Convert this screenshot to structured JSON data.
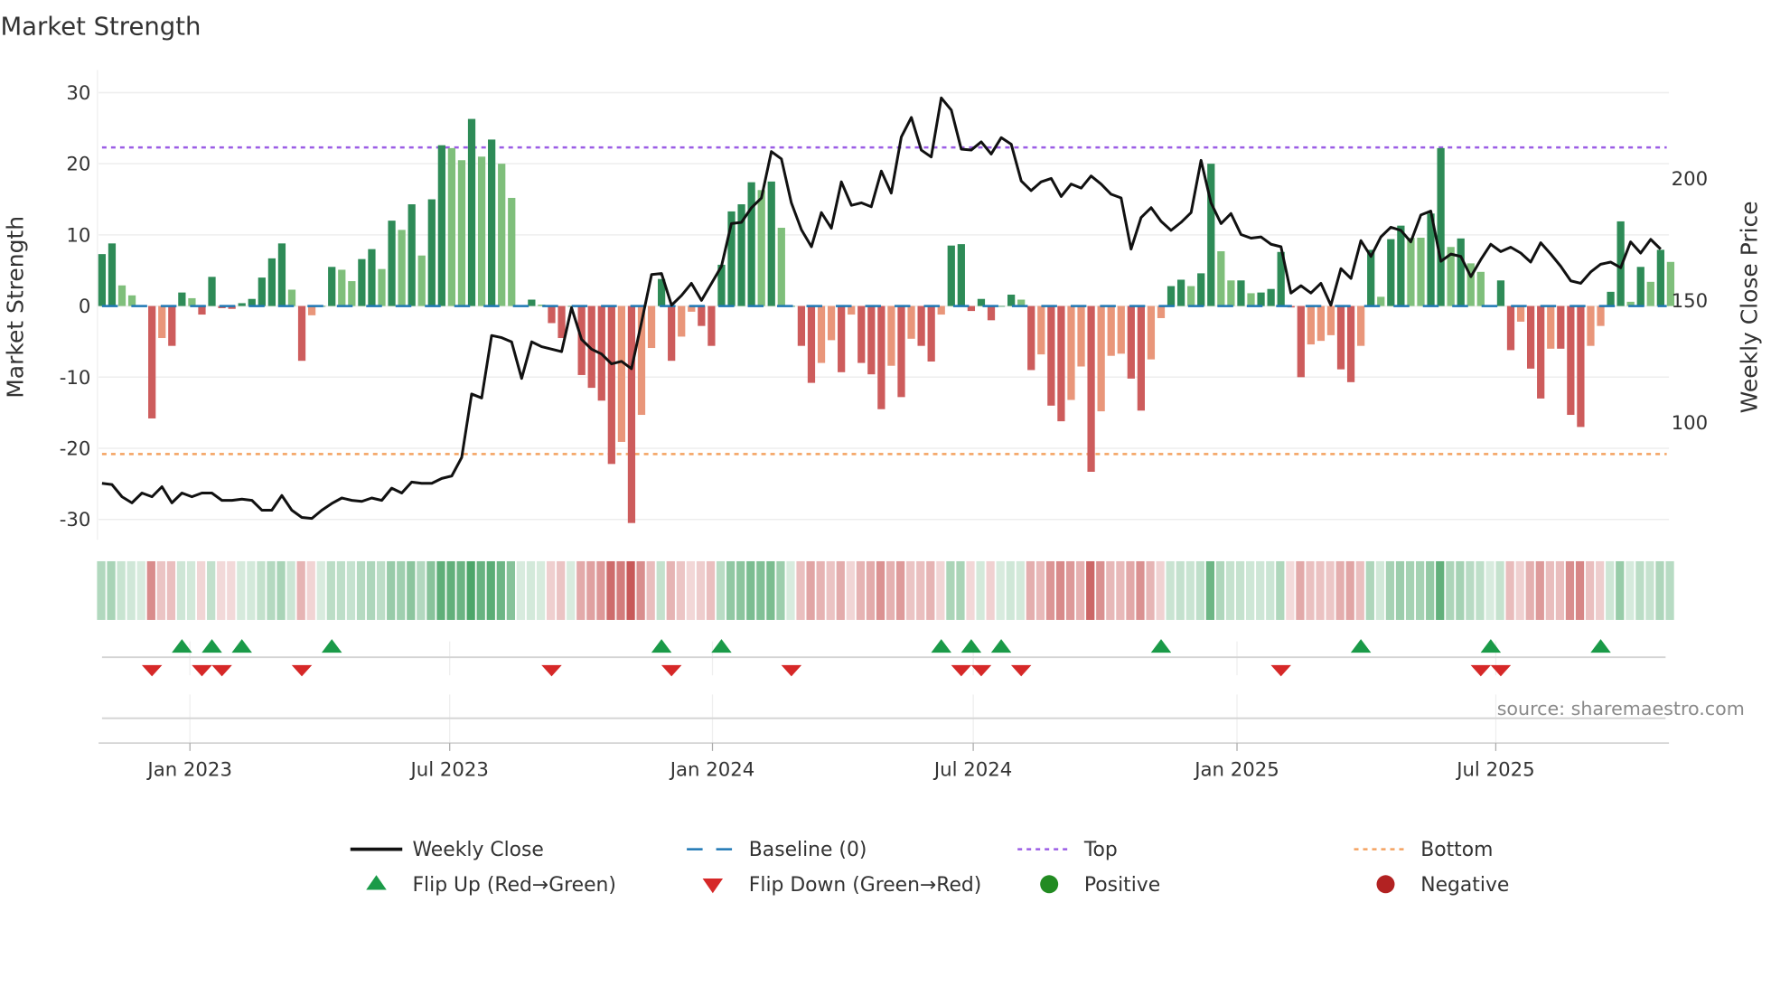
{
  "chart_data": {
    "type": "bar",
    "title": "Market Strength",
    "ylabel": "Market Strength",
    "y2label": "Weekly Close Price",
    "ylim": [
      -32,
      32
    ],
    "y2lim": [
      50,
      240
    ],
    "yticks": [
      30,
      20,
      10,
      0,
      -10,
      -20,
      -30
    ],
    "y2ticks": [
      200,
      150,
      100
    ],
    "top_level": 22.3,
    "bottom_level": -20.8,
    "baseline": 0,
    "xticks": [
      {
        "label": "Jan 2023",
        "week_index": 8.8
      },
      {
        "label": "Jul 2023",
        "week_index": 34.8
      },
      {
        "label": "Jan 2024",
        "week_index": 61.1
      },
      {
        "label": "Jul 2024",
        "week_index": 87.2
      },
      {
        "label": "Jan 2025",
        "week_index": 113.6
      },
      {
        "label": "Jul 2025",
        "week_index": 139.5
      }
    ],
    "strength": [
      7.3,
      8.8,
      2.9,
      1.5,
      0,
      -15.8,
      -4.5,
      -5.6,
      1.9,
      1.1,
      -1.2,
      4.1,
      -0.3,
      -0.4,
      0.4,
      1,
      4,
      6.7,
      8.8,
      2.3,
      -7.7,
      -1.3,
      0,
      5.5,
      5.1,
      3.5,
      6.6,
      8,
      5.2,
      12,
      10.7,
      14.3,
      7.1,
      15,
      22.6,
      22.2,
      20.5,
      26.3,
      21,
      23.4,
      20,
      15.2,
      0,
      0.9,
      0.2,
      -2.4,
      -4.5,
      0,
      -9.7,
      -11.5,
      -13.3,
      -22.2,
      -19.1,
      -30.5,
      -15.3,
      -5.9,
      3.8,
      -7.7,
      -4.3,
      -0.8,
      -2.8,
      -5.6,
      5.8,
      13.3,
      14.3,
      17.4,
      16.3,
      17.5,
      11,
      0,
      -5.6,
      -10.8,
      -8,
      -4.8,
      -9.3,
      -1.2,
      -8,
      -9.6,
      -14.5,
      -8.4,
      -12.8,
      -4.6,
      -5.6,
      -7.8,
      -1.2,
      8.5,
      8.7,
      -0.7,
      1,
      -2,
      0,
      1.6,
      0.9,
      -9,
      -6.8,
      -14,
      -16.2,
      -13.2,
      -8.5,
      -23.3,
      -14.8,
      -7,
      -6.7,
      -10.2,
      -14.7,
      -7.5,
      -1.7,
      2.8,
      3.7,
      2.8,
      4.6,
      20,
      7.7,
      3.6,
      3.6,
      1.8,
      1.9,
      2.4,
      7.6,
      -0.2,
      -10,
      -5.4,
      -4.9,
      -4.1,
      -8.9,
      -10.7,
      -5.6,
      7.9,
      1.3,
      9.4,
      11.3,
      9.6,
      9.6,
      13,
      22.2,
      8.3,
      9.5,
      6,
      4.8,
      0,
      3.6,
      -6.2,
      -2.2,
      -8.8,
      -13,
      -6,
      -6,
      -15.3,
      -17,
      -5.6,
      -2.8,
      2,
      11.9,
      0.6,
      5.5,
      3.4,
      7.9,
      6.2
    ],
    "strength_shade": "DDLLDDLDDLDDDDDDDDDLDLDDLLDDLDLDLDDLLDLDLLDDLDDDDDDDLDLLDDLLDDDDDDLDLDDDLLDLDDDLDLDDLDDDDDDDLDLDDLLDLLLDDLLDDLDDLLDLDDDDDLLLDDLDLDDLLDDLDLLDDDLDDLDDDLLDDLDLDL",
    "weekly_close": [
      75,
      74.5,
      69.5,
      67,
      71,
      69.5,
      73.6,
      67,
      71,
      69.5,
      71,
      71,
      68,
      68,
      68.5,
      68,
      64,
      64,
      70,
      64,
      61,
      60.6,
      64,
      66.7,
      69,
      68,
      67.6,
      69,
      68,
      73,
      71,
      75.5,
      75,
      75,
      77,
      78,
      85.6,
      111.6,
      110,
      135.6,
      134.7,
      133,
      118,
      133,
      131,
      130,
      129,
      147,
      134,
      130,
      128,
      124,
      125,
      122,
      141,
      160.6,
      161,
      148,
      152,
      157,
      150,
      157,
      164,
      181.5,
      182,
      188,
      192,
      211,
      208,
      190,
      179,
      172,
      186,
      179.6,
      198.6,
      189,
      190,
      188.4,
      203,
      194,
      217,
      225,
      211.6,
      208.8,
      233,
      228,
      212,
      211.6,
      215,
      210,
      216.7,
      214,
      199,
      195,
      198.6,
      200,
      192.6,
      197.7,
      196,
      201,
      197.7,
      193.5,
      192,
      171,
      184,
      188,
      182.4,
      178.7,
      182,
      186,
      207.4,
      190,
      181.5,
      185.6,
      177,
      175.5,
      176,
      173,
      172,
      153,
      156,
      153,
      157,
      148,
      163,
      159,
      174.5,
      168,
      176,
      180,
      178.7,
      174,
      185,
      186.6,
      166,
      169,
      168,
      159.7,
      166.7,
      173,
      170,
      171.8,
      169.4,
      165.7,
      173.6,
      169,
      164,
      158,
      157,
      161.6,
      164.8,
      165.7,
      163.4,
      174,
      169.4,
      175,
      171
    ],
    "flip_up_weeks": [
      8,
      11,
      14,
      23,
      56,
      62,
      84,
      87,
      90,
      106,
      126,
      139,
      150
    ],
    "flip_down_weeks": [
      5,
      10,
      12,
      20,
      45,
      57,
      69,
      86,
      88,
      92,
      118,
      138,
      140
    ],
    "legend": [
      {
        "label": "Weekly Close",
        "kind": "solid-line",
        "color": "#111111"
      },
      {
        "label": "Baseline (0)",
        "kind": "dash-line",
        "color": "#1f77b4"
      },
      {
        "label": "Top",
        "kind": "dot-line",
        "color": "#9b5de5"
      },
      {
        "label": "Bottom",
        "kind": "dot-line",
        "color": "#f4a261"
      },
      {
        "label": "Flip Up (Red→Green)",
        "kind": "tri-up",
        "color": "#1a9a48"
      },
      {
        "label": "Flip Down (Green→Red)",
        "kind": "tri-down",
        "color": "#d62828"
      },
      {
        "label": "Positive",
        "kind": "dot",
        "color": "#228b22"
      },
      {
        "label": "Negative",
        "kind": "dot",
        "color": "#b22222"
      }
    ],
    "legend_placement": "bottom",
    "source": "source: sharemaestro.com",
    "colors": {
      "pos_strong": "#2e8b57",
      "pos_weak": "#7fbf7b",
      "neg_strong": "#cd5c5c",
      "neg_weak": "#e9967a"
    }
  }
}
